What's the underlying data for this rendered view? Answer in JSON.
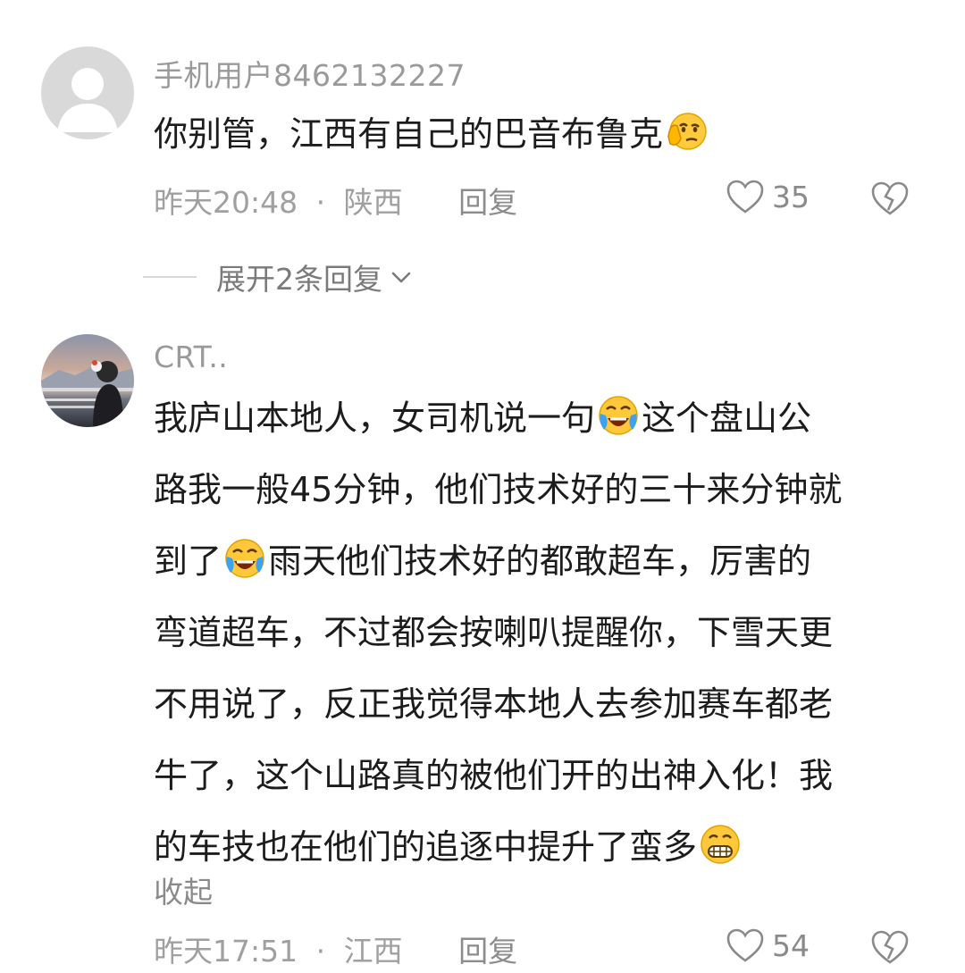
{
  "comments": [
    {
      "username": "手机用户8462132227",
      "lines": [
        {
          "segments": [
            "你别管，江西有自己的巴音布鲁克"
          ],
          "emoji_after": [
            "thinking-emoji"
          ]
        }
      ],
      "time": "昨天20:48",
      "location": "陕西",
      "separator": "·",
      "reply_label": "回复",
      "likes": "35",
      "expand_label": "展开2条回复"
    },
    {
      "username": "CRT..",
      "lines": [
        {
          "segments": [
            "我庐山本地人，女司机说一句",
            "这个盘山公"
          ],
          "emoji_after": [
            "laughing-crying-emoji"
          ]
        },
        {
          "segments": [
            "路我一般45分钟，他们技术好的三十来分钟就"
          ]
        },
        {
          "segments": [
            "到了",
            "雨天他们技术好的都敢超车，厉害的"
          ],
          "emoji_after": [
            "laughing-crying-emoji"
          ]
        },
        {
          "segments": [
            "弯道超车，不过都会按喇叭提醒你，下雪天更"
          ]
        },
        {
          "segments": [
            "不用说了，反正我觉得本地人去参加赛车都老"
          ]
        },
        {
          "segments": [
            "牛了，这个山路真的被他们开的出神入化！我"
          ]
        },
        {
          "segments": [
            "的车技也在他们的追逐中提升了蛮多"
          ],
          "emoji_after": [
            "grinning-emoji"
          ]
        }
      ],
      "collapse_label": "收起",
      "time": "昨天17:51",
      "location": "江西",
      "separator": "·",
      "reply_label": "回复",
      "likes": "54"
    }
  ]
}
